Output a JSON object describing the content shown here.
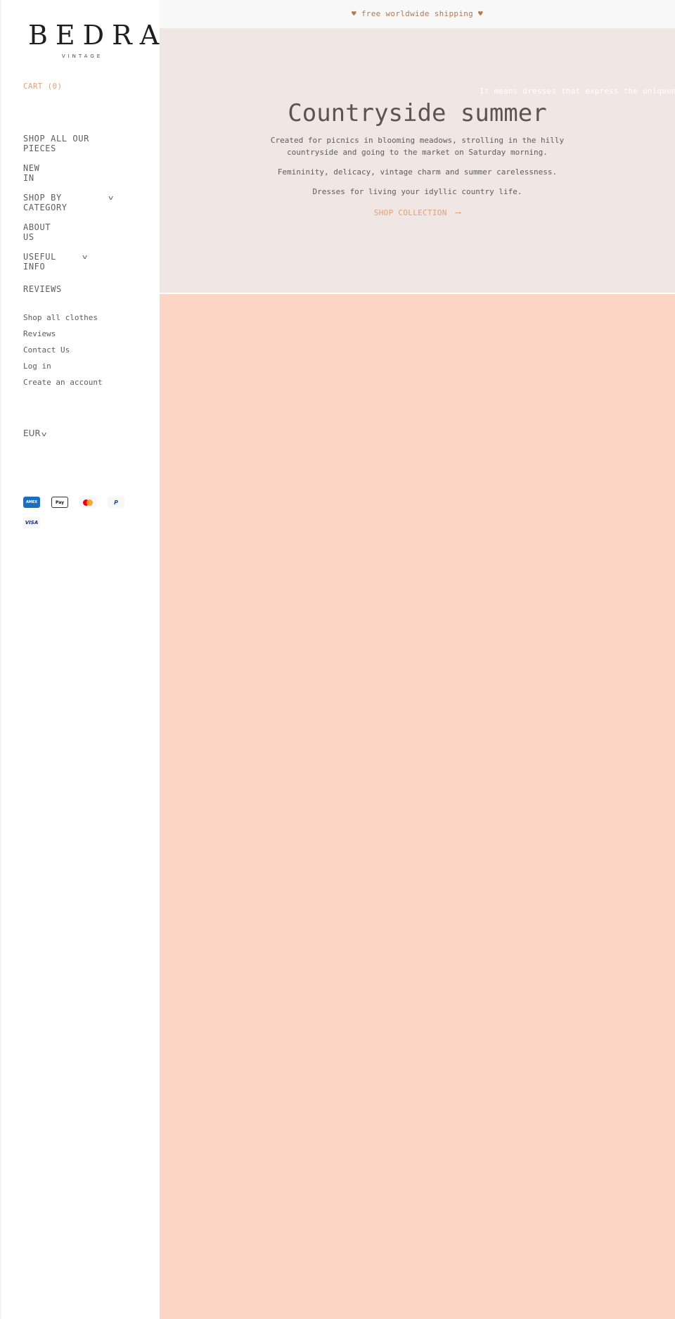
{
  "sidebar": {
    "logo": {
      "name": "BEDRA",
      "tagline": "VINTAGE"
    },
    "cart_label": "CART (0)",
    "main_nav": [
      {
        "label": "SHOP ALL OUR\nPIECES",
        "has_dropdown": false
      },
      {
        "label": "NEW\nIN",
        "has_dropdown": false
      },
      {
        "label": "SHOP BY\nCATEGORY",
        "has_dropdown": true
      },
      {
        "label": "ABOUT\nUS",
        "has_dropdown": false
      },
      {
        "label": "USEFUL\nINFO",
        "has_dropdown": true
      },
      {
        "label": "REVIEWS",
        "has_dropdown": false
      }
    ],
    "secondary_nav": [
      "Shop all clothes",
      "Reviews",
      "Contact Us",
      "Log in",
      "Create an account"
    ],
    "currency": "EUR",
    "payment_icons": [
      "amex-icon",
      "apple-pay-icon",
      "mastercard-icon",
      "paypal-icon",
      "visa-icon"
    ],
    "payment_labels": {
      "amex": "AMEX",
      "apple": "Pay",
      "paypal": "P",
      "visa": "VISA"
    }
  },
  "announcement": "♥ free worldwide shipping ♥",
  "hero": {
    "marquee": "It means dresses that express the uniqueness, s",
    "title": "Countryside summer",
    "paragraphs": [
      "Created for picnics in blooming meadows, strolling in the hilly countryside and going to the market on Saturday morning.",
      "Femininity, delicacy, vintage charm and summer carelessness.",
      "Dresses for living your idyllic country life."
    ],
    "cta_label": "SHOP COLLECTION"
  },
  "colors": {
    "accent": "#dba37c",
    "hero_bg": "#f0e6e4",
    "section_bg": "#fcd5c4",
    "topbar_bg": "#f9f8f8",
    "text": "#5d5d5d"
  }
}
